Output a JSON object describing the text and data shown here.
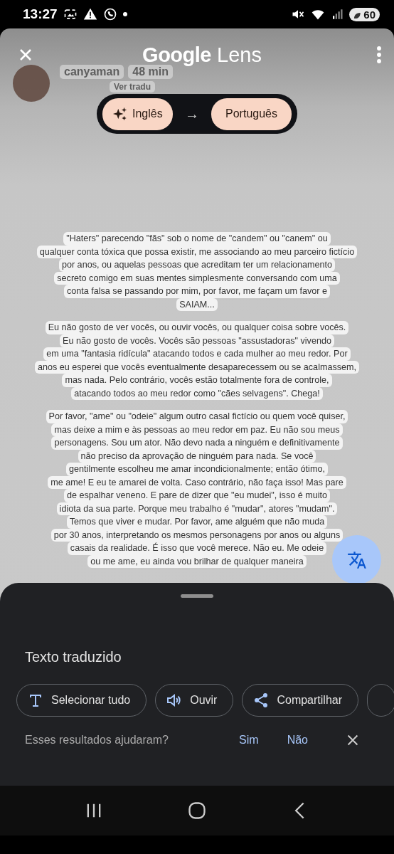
{
  "status_bar": {
    "time": "13:27",
    "battery": "60"
  },
  "header": {
    "brand": "Google",
    "product": "Lens"
  },
  "background_post": {
    "username": "canyaman",
    "time": "48 min",
    "translate_link": "Ver tradu"
  },
  "languages": {
    "source": "Inglês",
    "arrow": "→",
    "target": "Português"
  },
  "translated_blocks": [
    {
      "lines": [
        "\"Haters\" parecendo \"fãs\" sob o nome de \"candem\" ou \"canem\" ou",
        "qualquer conta tóxica que possa existir, me associando ao meu parceiro fictício",
        "por anos, ou aquelas pessoas que acreditam ter um relacionamento",
        "secreto comigo em suas mentes simplesmente conversando com uma",
        "conta falsa se passando por mim, por favor, me façam um favor e",
        "SAIAM..."
      ]
    },
    {
      "lines": [
        "Eu não gosto de ver vocês, ou ouvir vocês, ou qualquer coisa sobre vocês.",
        "Eu não gosto de vocês. Vocês são pessoas \"assustadoras\" vivendo",
        "em uma \"fantasia ridícula\" atacando todos e cada mulher ao meu redor. Por",
        "anos eu esperei que vocês eventualmente desaparecessem ou se acalmassem,",
        "mas nada. Pelo contrário, vocês estão totalmente fora de controle,",
        "atacando todos ao meu redor como \"cães selvagens\". Chega!"
      ]
    },
    {
      "lines": [
        "Por favor, \"ame\" ou \"odeie\" algum outro casal fictício ou quem você quiser,",
        "mas deixe a mim e às pessoas ao meu redor em paz. Eu não sou meus",
        "personagens. Sou um ator. Não devo nada a ninguém e definitivamente",
        "não preciso da aprovação de ninguém para nada. Se você",
        "gentilmente escolheu me amar incondicionalmente; então ótimo,",
        "me ame! E eu te amarei de volta. Caso contrário, não faça isso! Mas pare",
        "de espalhar veneno. E pare de dizer que \"eu mudei\", isso é muito",
        "idiota da sua parte. Porque meu trabalho é \"mudar\", atores \"mudam\".",
        "Temos que viver e mudar. Por favor, ame alguém que não muda",
        "por 30 anos, interpretando os mesmos personagens por anos ou alguns",
        "casais da realidade. É isso que você merece. Não eu. Me odeie",
        "ou me ame, eu ainda vou brilhar de qualquer maneira"
      ]
    }
  ],
  "sheet": {
    "title": "Texto traduzido",
    "actions": [
      {
        "kind": "select",
        "label": "Selecionar tudo"
      },
      {
        "kind": "listen",
        "label": "Ouvir"
      },
      {
        "kind": "share",
        "label": "Compartilhar"
      }
    ],
    "feedback": {
      "question": "Esses resultados ajudaram?",
      "yes": "Sim",
      "no": "Não"
    }
  }
}
